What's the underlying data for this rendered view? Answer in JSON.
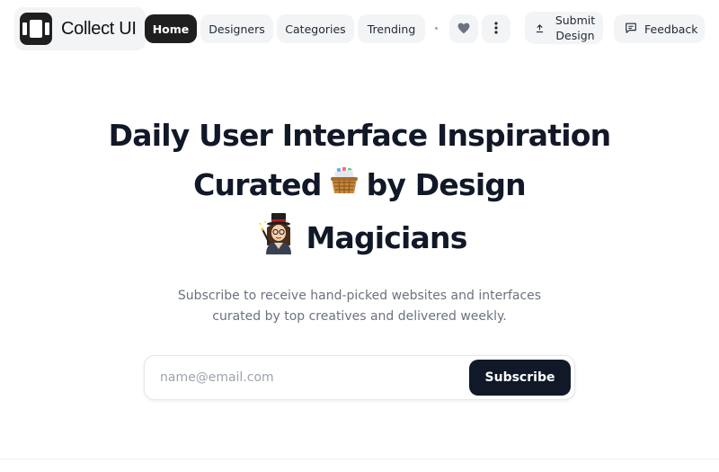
{
  "brand": {
    "name": "Collect UI",
    "logo_icon": "video-frames-icon"
  },
  "nav": {
    "items": [
      {
        "label": "Home",
        "active": true
      },
      {
        "label": "Designers",
        "active": false
      },
      {
        "label": "Categories",
        "active": false
      },
      {
        "label": "Trending",
        "active": false
      }
    ],
    "favorites_icon": "heart-icon",
    "more_icon": "more-vertical-icon",
    "submit_label": "Submit\nDesign",
    "submit_icon": "upload-icon",
    "feedback_label": "Feedback",
    "feedback_icon": "message-icon"
  },
  "hero": {
    "line1": "Daily User Interface Inspiration",
    "line2_before": "Curated",
    "line2_after": "by Design",
    "line3": "Magicians",
    "basket_emoji": "basket-emoji",
    "magician_emoji": "magician-emoji"
  },
  "subtitle": {
    "line1": "Subscribe to receive hand-picked websites and interfaces",
    "line2": "curated by top creatives and delivered weekly."
  },
  "form": {
    "placeholder": "name@email.com",
    "value": "",
    "button_label": "Subscribe"
  },
  "colors": {
    "accent": "#111827",
    "nav_active": "#1f1f1f",
    "pill_bg": "#f3f4f6"
  }
}
